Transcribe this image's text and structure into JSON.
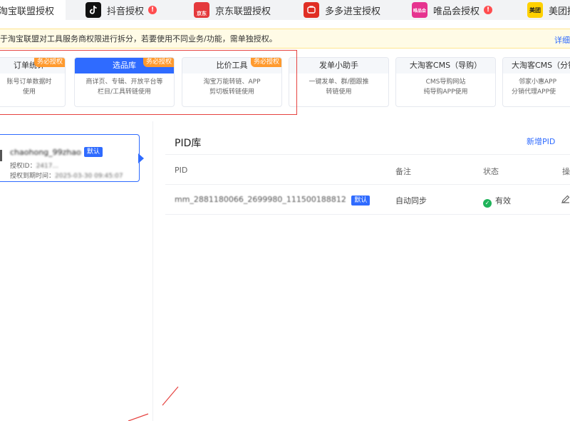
{
  "platform_tabs": [
    {
      "label": "淘宝联盟授权",
      "active": true
    },
    {
      "label": "抖音授权",
      "icon": "douyin-icon",
      "alert": "!"
    },
    {
      "label": "京东联盟授权",
      "icon": "jd-icon",
      "icon_text": "京东"
    },
    {
      "label": "多多进宝授权",
      "icon": "pinduoduo-icon"
    },
    {
      "label": "唯品会授权",
      "icon": "vipshop-icon",
      "icon_text": "唯品会",
      "alert": "!"
    },
    {
      "label": "美团授权",
      "icon": "meituan-icon",
      "icon_text": "美团"
    }
  ],
  "notice": {
    "text": "于淘宝联盟对工具服务商权限进行拆分，若要使用不同业务/功能，需单独授权。",
    "link": "详细"
  },
  "cards": [
    {
      "title": "订单统计",
      "desc1": "账号订单数据时",
      "desc2": "使用",
      "required": "务必授权"
    },
    {
      "title": "选品库",
      "desc1": "商详页、专辑、开放平台等",
      "desc2": "栏目/工具转链使用",
      "required": "务必授权",
      "selected": true
    },
    {
      "title": "比价工具",
      "desc1": "淘宝万能转链、APP",
      "desc2": "剪切板转链使用",
      "required": "务必授权"
    },
    {
      "title": "发单小助手",
      "desc1": "一键发单、群/圈跟推",
      "desc2": "转链使用"
    },
    {
      "title": "大淘客CMS（导购）",
      "desc1": "CMS导购网站",
      "desc2": "纯导购APP使用"
    },
    {
      "title": "大淘客CMS（分销",
      "desc1": "邻家小惠APP",
      "desc2": "分销代理APP使"
    }
  ],
  "account": {
    "name": "chaohong_99zhao",
    "badge": "默认",
    "id_label": "授权ID：",
    "id_value": "2417...",
    "expire_label": "授权到期时间：",
    "expire_value": "2025-03-30 09:45:07"
  },
  "pid": {
    "title": "PID库",
    "add_button": "新增PID",
    "columns": [
      "PID",
      "备注",
      "状态",
      "操"
    ],
    "rows": [
      {
        "pid": "mm_2881180066_2699980_111500188812",
        "badge": "默认",
        "note": "自动同步",
        "status": "有效"
      }
    ]
  },
  "colors": {
    "accent": "#2f6bff",
    "required_badge": "#ff9a2e",
    "highlight_box": "#e64340",
    "status_ok": "#1fb35a"
  }
}
